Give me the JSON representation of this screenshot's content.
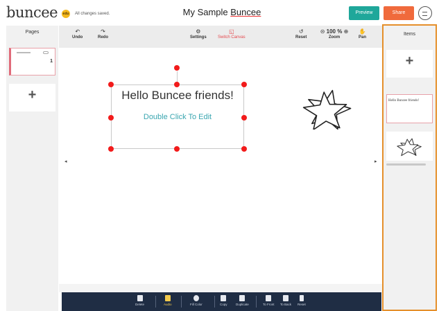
{
  "header": {
    "logo_text": "buncee",
    "logo_badge": "edu",
    "save_status": "All changes saved.",
    "title_prefix": "My Sample ",
    "title_suffix": "Buncee",
    "preview_label": "Preview",
    "share_label": "Share"
  },
  "pages_panel": {
    "title": "Pages",
    "pages": [
      {
        "number": "1"
      }
    ],
    "add_label": "+"
  },
  "toolbar": {
    "undo": {
      "icon": "undo-icon",
      "label": "Undo"
    },
    "redo": {
      "icon": "redo-icon",
      "label": "Redo"
    },
    "settings": {
      "icon": "gear-icon",
      "label": "Settings"
    },
    "switch_canvas": {
      "icon": "switch-canvas-icon",
      "label": "Switch Canvas",
      "color": "#e5484d"
    },
    "reset": {
      "icon": "reset-icon",
      "label": "Reset"
    },
    "zoom": {
      "value": "100 %",
      "label": "Zoom",
      "minus": "⊝",
      "plus": "⊕"
    },
    "pan": {
      "icon": "hand-icon",
      "label": "Pan"
    }
  },
  "canvas": {
    "heading": "Hello Buncee friends!",
    "subtext": "Double Click To Edit",
    "left_arrow": "◂",
    "right_arrow": "▸",
    "selection_handle_color": "#f21b1b"
  },
  "items_panel": {
    "title": "Items",
    "add_label": "+",
    "text_item": "Hello Buncee friends!",
    "star_item": "star-icon"
  },
  "bottom_bar": {
    "tools": [
      {
        "icon": "trash-icon",
        "label": "Delete"
      },
      {
        "icon": "audio-icon",
        "label": "Audio",
        "active": true
      },
      {
        "icon": "fill-color-icon",
        "label": "Fill Color"
      },
      {
        "icon": "copy-icon",
        "label": "Copy"
      },
      {
        "icon": "duplicate-icon",
        "label": "Duplicate"
      },
      {
        "icon": "to-front-icon",
        "label": "To Front"
      },
      {
        "icon": "to-back-icon",
        "label": "To Back"
      },
      {
        "icon": "reset-icon",
        "label": "Reset"
      }
    ]
  },
  "colors": {
    "preview": "#1fa79a",
    "share": "#f06a3c",
    "items_panel_border": "#e58f2a",
    "bottom_bar": "#1f2d44",
    "subtext": "#3aa6b0"
  }
}
